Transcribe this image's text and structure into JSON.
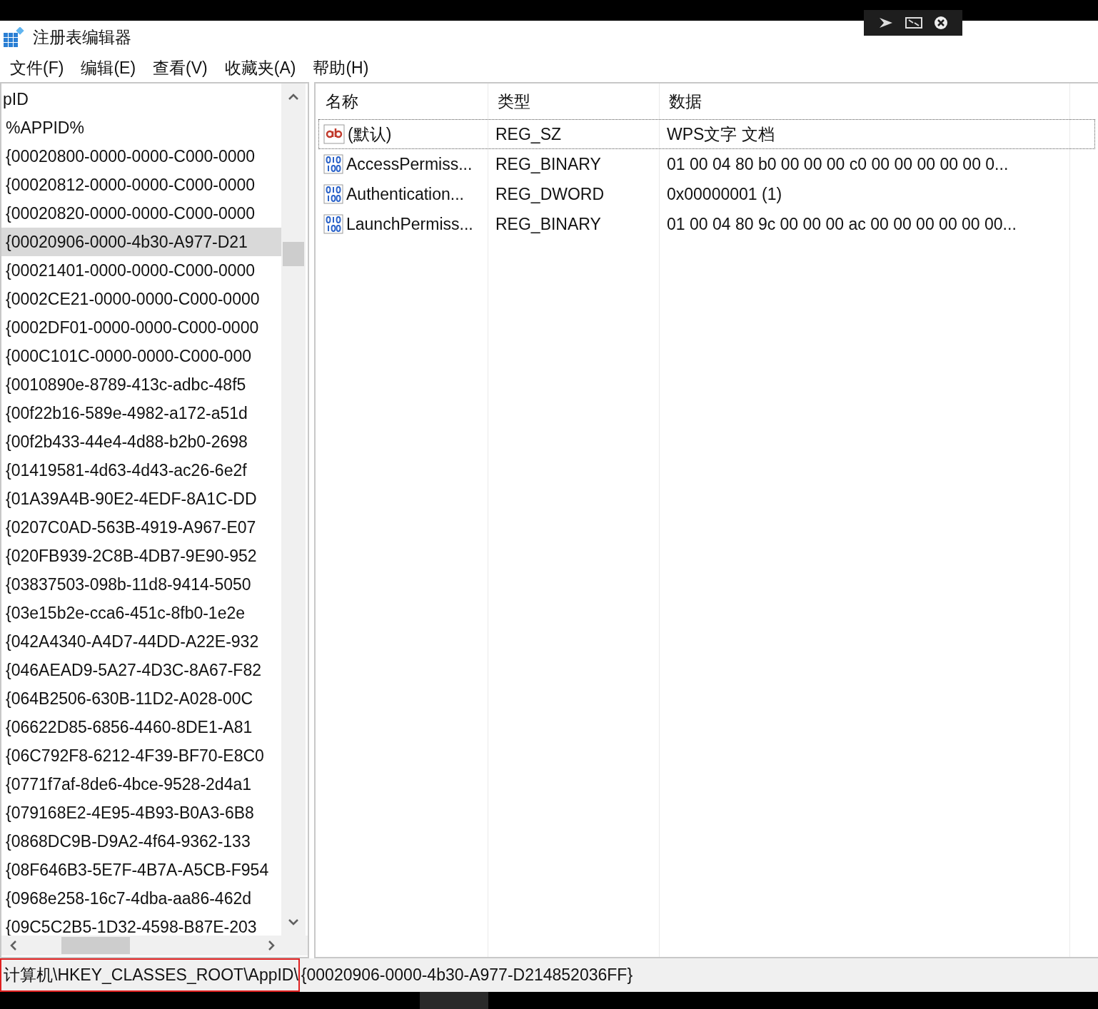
{
  "window": {
    "title": "注册表编辑器"
  },
  "menu": [
    "文件(F)",
    "编辑(E)",
    "查看(V)",
    "收藏夹(A)",
    "帮助(H)"
  ],
  "tree": {
    "label": "pID",
    "selected": false,
    "children": [
      {
        "label": "%APPID%",
        "selected": false
      },
      {
        "label": "{00020800-0000-0000-C000-0000",
        "selected": false
      },
      {
        "label": "{00020812-0000-0000-C000-0000",
        "selected": false
      },
      {
        "label": "{00020820-0000-0000-C000-0000",
        "selected": false
      },
      {
        "label": "{00020906-0000-4b30-A977-D21",
        "selected": true
      },
      {
        "label": "{00021401-0000-0000-C000-0000",
        "selected": false
      },
      {
        "label": "{0002CE21-0000-0000-C000-0000",
        "selected": false
      },
      {
        "label": "{0002DF01-0000-0000-C000-0000",
        "selected": false
      },
      {
        "label": "{000C101C-0000-0000-C000-000",
        "selected": false
      },
      {
        "label": "{0010890e-8789-413c-adbc-48f5",
        "selected": false
      },
      {
        "label": "{00f22b16-589e-4982-a172-a51d",
        "selected": false
      },
      {
        "label": "{00f2b433-44e4-4d88-b2b0-2698",
        "selected": false
      },
      {
        "label": "{01419581-4d63-4d43-ac26-6e2f",
        "selected": false
      },
      {
        "label": "{01A39A4B-90E2-4EDF-8A1C-DD",
        "selected": false
      },
      {
        "label": "{0207C0AD-563B-4919-A967-E07",
        "selected": false
      },
      {
        "label": "{020FB939-2C8B-4DB7-9E90-952",
        "selected": false
      },
      {
        "label": "{03837503-098b-11d8-9414-5050",
        "selected": false
      },
      {
        "label": "{03e15b2e-cca6-451c-8fb0-1e2e",
        "selected": false
      },
      {
        "label": "{042A4340-A4D7-44DD-A22E-932",
        "selected": false
      },
      {
        "label": "{046AEAD9-5A27-4D3C-8A67-F82",
        "selected": false
      },
      {
        "label": "{064B2506-630B-11D2-A028-00C",
        "selected": false
      },
      {
        "label": "{06622D85-6856-4460-8DE1-A81",
        "selected": false
      },
      {
        "label": "{06C792F8-6212-4F39-BF70-E8C0",
        "selected": false
      },
      {
        "label": "{0771f7af-8de6-4bce-9528-2d4a1",
        "selected": false
      },
      {
        "label": "{079168E2-4E95-4B93-B0A3-6B8",
        "selected": false
      },
      {
        "label": "{0868DC9B-D9A2-4f64-9362-133",
        "selected": false
      },
      {
        "label": "{08F646B3-5E7F-4B7A-A5CB-F954",
        "selected": false
      },
      {
        "label": "{0968e258-16c7-4dba-aa86-462d",
        "selected": false
      },
      {
        "label": "{09C5C2B5-1D32-4598-B87E-203",
        "selected": false
      }
    ]
  },
  "table": {
    "columns": [
      "名称",
      "类型",
      "数据"
    ],
    "rows": [
      {
        "kind": "string",
        "name": "(默认)",
        "type": "REG_SZ",
        "data": "WPS文字 文档",
        "selected": true
      },
      {
        "kind": "binary",
        "name": "AccessPermiss...",
        "type": "REG_BINARY",
        "data": "01 00 04 80 b0 00 00 00 c0 00 00 00 00 00 0...",
        "selected": false
      },
      {
        "kind": "binary",
        "name": "Authentication...",
        "type": "REG_DWORD",
        "data": "0x00000001 (1)",
        "selected": false
      },
      {
        "kind": "binary",
        "name": "LaunchPermiss...",
        "type": "REG_BINARY",
        "data": "01 00 04 80 9c 00 00 00 ac 00 00 00 00 00 00...",
        "selected": false
      }
    ]
  },
  "status_bar": {
    "segments": [
      {
        "text": "计算机\\HKEY_CLASSES_ROOT\\AppID\\",
        "highlighted": true
      },
      {
        "text": "{00020906-0000-4b30-A977-D214852036FF}",
        "highlighted": false
      }
    ]
  }
}
